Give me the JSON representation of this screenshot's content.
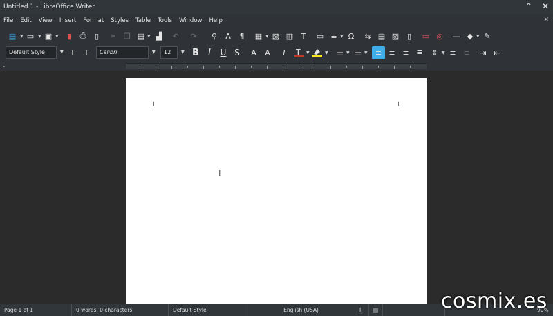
{
  "window": {
    "title": "Untitled 1 - LibreOffice Writer"
  },
  "menu": [
    "File",
    "Edit",
    "View",
    "Insert",
    "Format",
    "Styles",
    "Table",
    "Tools",
    "Window",
    "Help"
  ],
  "formatting": {
    "paragraph_style": "Default Style",
    "font_name": "Calibri",
    "font_size": "12",
    "text_color": "#c0392b",
    "highlight_color": "#f5e51b",
    "accent": "#3daee9"
  },
  "status": {
    "page": "Page 1 of 1",
    "word_count": "0 words, 0 characters",
    "page_style": "Default Style",
    "language": "English (USA)",
    "zoom": "90%"
  },
  "watermark": "cosmix.es"
}
